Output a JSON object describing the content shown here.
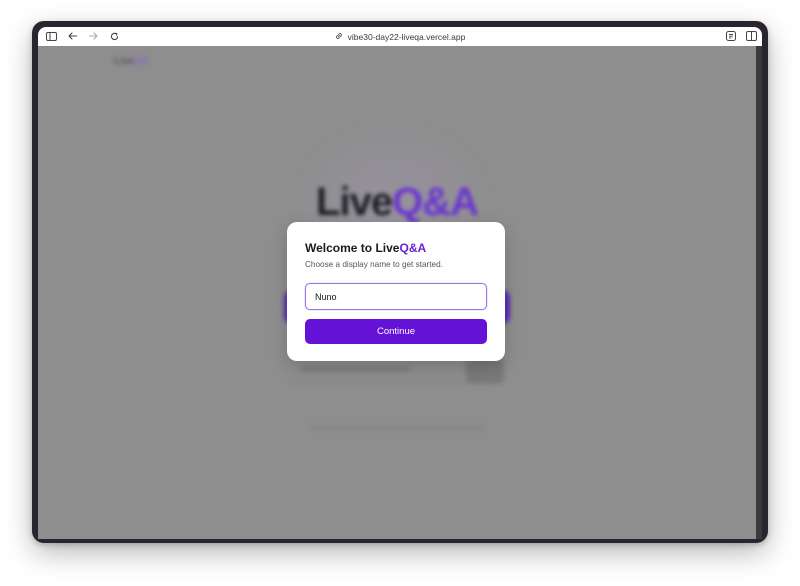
{
  "browser": {
    "url": "vibe30-day22-liveqa.vercel.app",
    "icons": [
      "sidebar-icon",
      "back-arrow-icon",
      "forward-arrow-icon",
      "reload-icon",
      "link-icon",
      "reader-icon",
      "split-view-icon"
    ]
  },
  "background_page": {
    "brand_prefix": "Live",
    "brand_suffix": "QA",
    "hero_prefix": "Live",
    "hero_suffix": "Q&A"
  },
  "modal": {
    "title_prefix": "Welcome to Live",
    "title_accent": "Q&A",
    "subtitle": "Choose a display name to get started.",
    "name_value": "Nuno",
    "continue_label": "Continue"
  },
  "colors": {
    "accent": "#6413d6",
    "overlay": "#8e8e8e",
    "window_frame": "#2a2330"
  }
}
